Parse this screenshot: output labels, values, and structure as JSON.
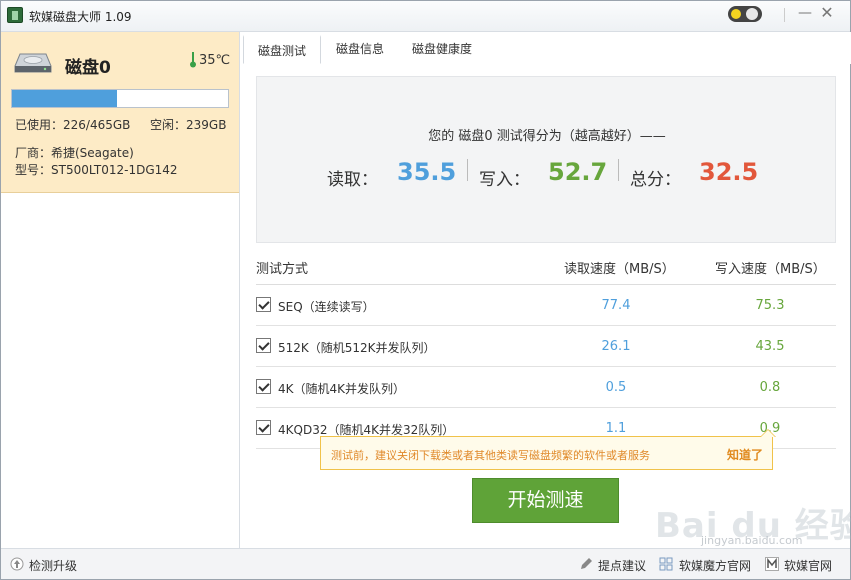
{
  "window": {
    "title": "软媒磁盘大师 1.09"
  },
  "disk": {
    "name": "磁盘0",
    "temperature": "35℃",
    "used_fraction": 0.486,
    "used_label": "已使用：226/465GB",
    "free_label": "空闲：239GB",
    "vendor_label": "厂商：希捷(Seagate)",
    "model_label": "型号：ST500LT012-1DG142"
  },
  "tabs": [
    {
      "label": "磁盘测试",
      "active": true
    },
    {
      "label": "磁盘信息",
      "active": false
    },
    {
      "label": "磁盘健康度",
      "active": false
    }
  ],
  "score": {
    "caption": "您的 磁盘0 测试得分为（越高越好）——",
    "read_label": "读取：",
    "read_value": "35.5",
    "write_label": "写入：",
    "write_value": "52.7",
    "total_label": "总分：",
    "total_value": "32.5",
    "colors": {
      "read": "#4f9fdc",
      "write": "#67a63c",
      "total": "#e2573b"
    }
  },
  "table": {
    "headers": [
      "测试方式",
      "读取速度（MB/S）",
      "写入速度（MB/S）"
    ],
    "rows": [
      {
        "label": "SEQ（连续读写）",
        "read": "77.4",
        "write": "75.3",
        "checked": true
      },
      {
        "label": "512K（随机512K并发队列）",
        "read": "26.1",
        "write": "43.5",
        "checked": true
      },
      {
        "label": "4K（随机4K并发队列）",
        "read": "0.5",
        "write": "0.8",
        "checked": true
      },
      {
        "label": "4KQD32（随机4K并发32队列）",
        "read": "1.1",
        "write": "0.9",
        "checked": true
      }
    ]
  },
  "tooltip": {
    "text": "测试前，建议关闭下载类或者其他类读写磁盘频繁的软件或者服务",
    "ack": "知道了"
  },
  "start_button": {
    "label": "开始测速",
    "color": "#5fa338"
  },
  "statusbar": {
    "update": "检测升级",
    "feedback": "提点建议",
    "mofang": "软媒魔方官网",
    "ruanmei": "软媒官网"
  },
  "watermark": {
    "text": "Bai du 经验",
    "domain": "jingyan.baidu.com"
  }
}
